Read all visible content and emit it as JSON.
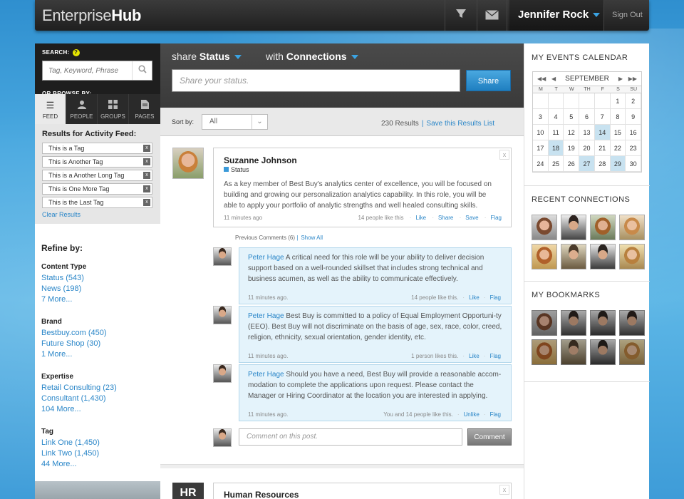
{
  "topbar": {
    "logo_light": "Enterprise",
    "logo_bold": "Hub",
    "user_name": "Jennifer Rock",
    "sign_out": "Sign Out",
    "icons": [
      "filter-icon",
      "mail-icon"
    ]
  },
  "left": {
    "search_label": "SEARCH:",
    "search_placeholder": "Tag, Keyword, Phrase",
    "browse_label": "OR BROWSE BY:",
    "tabs": [
      {
        "label": "FEED",
        "icon": "list-icon",
        "active": true
      },
      {
        "label": "PEOPLE",
        "icon": "person-icon",
        "active": false
      },
      {
        "label": "GROUPS",
        "icon": "grid-icon",
        "active": false
      },
      {
        "label": "PAGES",
        "icon": "document-icon",
        "active": false
      }
    ],
    "results_title": "Results for Activity Feed:",
    "tags": [
      "This is a Tag",
      "This is Another Tag",
      "This is a Another Long Tag",
      "This is One More Tag",
      "This is the Last Tag"
    ],
    "clear_results": "Clear Results",
    "refine_title": "Refine by:",
    "groups": [
      {
        "title": "Content Type",
        "links": [
          "Status (543)",
          "News (198)",
          "7 More..."
        ]
      },
      {
        "title": "Brand",
        "links": [
          "Bestbuy.com (450)",
          "Future Shop (30)",
          "1 More..."
        ]
      },
      {
        "title": "Expertise",
        "links": [
          "Retail Consulting (23)",
          "Consultant (1,430)",
          "104 More..."
        ]
      },
      {
        "title": "Tag",
        "links": [
          "Link One (1,450)",
          "Link Two (1,450)",
          "44 More..."
        ]
      }
    ]
  },
  "center": {
    "share_prefix": "share",
    "share_bold": "Status",
    "with_prefix": "with",
    "with_bold": "Connections",
    "status_placeholder": "Share your status.",
    "share_button": "Share",
    "sort_label": "Sort by:",
    "sort_value": "All",
    "results_count": "230 Results",
    "save_list": "Save this Results List",
    "post": {
      "author": "Suzanne Johnson",
      "type": "Status",
      "body": "As a key member of Best Buy's analytics center of excellence, you will be focused on building and growing our personalization analytics capability. In this role, you will be able to apply your portfolio of analytic strengths and well healed consulting skills.",
      "time": "11 minutes ago",
      "likes": "14 people like this",
      "actions": [
        "Like",
        "Share",
        "Save",
        "Flag"
      ]
    },
    "previous_comments": "Previous Comments (6)",
    "show_all": "Show All",
    "comments": [
      {
        "author": "Peter Hage",
        "text": "A critical need for this role will be your ability to deliver decision support based on a well-rounded skillset that includes strong technical and business acumen, as well as the ability to communicate effectively.",
        "time": "11 minutes ago.",
        "likes": "14 people like this.",
        "actions": [
          "Like",
          "Flag"
        ]
      },
      {
        "author": "Peter Hage",
        "text": "Best Buy is committed to a policy of Equal Employment Opportuni-ty (EEO). Best Buy will not discriminate on the basis of age, sex, race, color, creed, religion, ethnicity, sexual orientation, gender identity, etc.",
        "time": "11 minutes ago.",
        "likes": "1 person likes this.",
        "actions": [
          "Like",
          "Flag"
        ]
      },
      {
        "author": "Peter Hage",
        "text": "Should you have a need, Best Buy will provide a reasonable accom-modation to complete the applications upon request. Please contact the Manager or Hiring Coordinator at the location you are interested in applying.",
        "time": "11 minutes ago.",
        "likes": "You and 14 people like this.",
        "actions": [
          "Unlike",
          "Flag"
        ]
      }
    ],
    "comment_placeholder": "Comment on this post.",
    "comment_button": "Comment",
    "next_post_initials": "HR",
    "next_post_author": "Human Resources"
  },
  "right": {
    "events_title": "MY EVENTS CALENDAR",
    "month": "SEPTEMBER",
    "dow": [
      "M",
      "T",
      "W",
      "TH",
      "F",
      "S",
      "SU"
    ],
    "days": [
      "",
      "",
      "",
      "",
      "",
      "1",
      "2",
      "3",
      "4",
      "5",
      "6",
      "7",
      "8",
      "9",
      "10",
      "11",
      "12",
      "13",
      "14",
      "15",
      "16",
      "17",
      "18",
      "19",
      "20",
      "21",
      "22",
      "23",
      "24",
      "25",
      "26",
      "27",
      "28",
      "29",
      "30"
    ],
    "highlighted_days": [
      "14",
      "18",
      "27",
      "29"
    ],
    "connections_title": "RECENT CONNECTIONS",
    "bookmarks_title": "MY BOOKMARKS"
  }
}
